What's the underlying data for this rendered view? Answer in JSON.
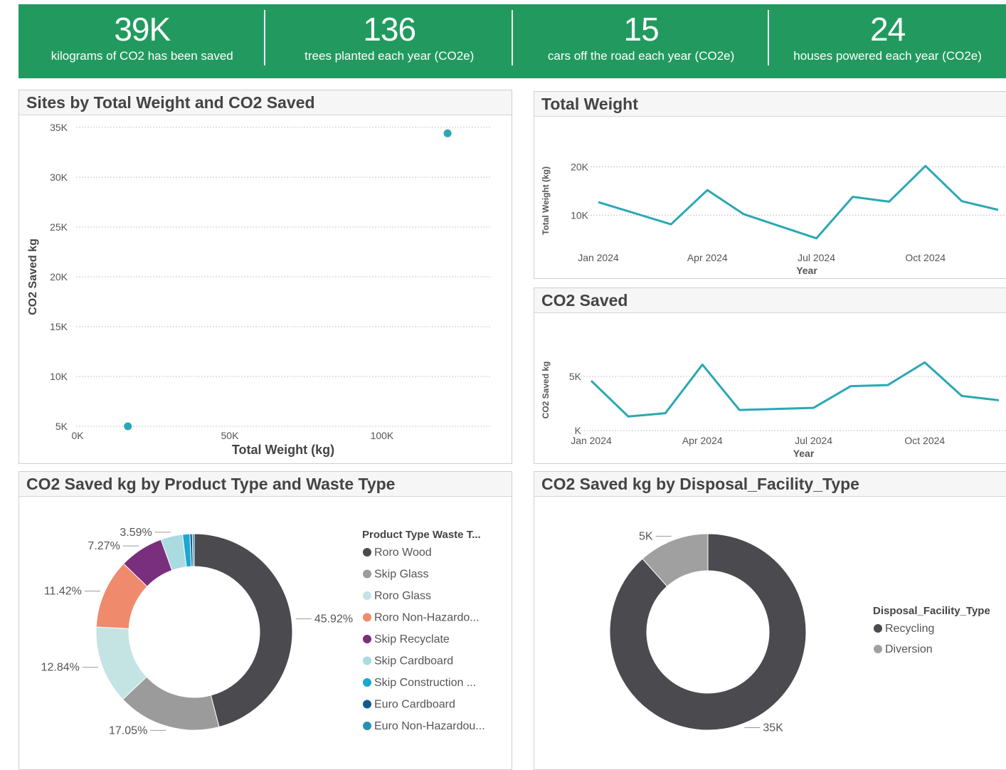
{
  "kpis": [
    {
      "value": "39K",
      "label": "kilograms of CO2 has been saved"
    },
    {
      "value": "136",
      "label": "trees planted each year (CO2e)"
    },
    {
      "value": "15",
      "label": "cars off the road each year (CO2e)"
    },
    {
      "value": "24",
      "label": "houses powered each year (CO2e)"
    }
  ],
  "panels": {
    "scatter_title": "Sites by Total Weight and CO2 Saved",
    "weight_title": "Total Weight",
    "co2_title": "CO2 Saved",
    "product_title": "CO2 Saved kg by Product Type and Waste Type",
    "facility_title": "CO2 Saved kg by Disposal_Facility_Type"
  },
  "colors": {
    "kpi_bg": "#229a5f",
    "line": "#2aa8b4",
    "dot": "#2aa8b4"
  },
  "chart_data": [
    {
      "id": "scatter",
      "type": "scatter",
      "title": "Sites by Total Weight and CO2 Saved",
      "xlabel": "Total Weight (kg)",
      "ylabel": "CO2 Saved kg",
      "xlim": [
        0,
        136000
      ],
      "ylim": [
        5000,
        35000
      ],
      "x_ticks": [
        "0K",
        "50K",
        "100K"
      ],
      "x_tick_values": [
        0,
        50000,
        100000
      ],
      "y_ticks": [
        "5K",
        "10K",
        "15K",
        "20K",
        "25K",
        "30K",
        "35K"
      ],
      "y_tick_values": [
        5000,
        10000,
        15000,
        20000,
        25000,
        30000,
        35000
      ],
      "points": [
        {
          "x": 17000,
          "y": 5000
        },
        {
          "x": 122000,
          "y": 34400
        }
      ],
      "grid": true
    },
    {
      "id": "weight",
      "type": "line",
      "title": "Total Weight",
      "xlabel": "Year",
      "ylabel": "Total Weight (kg)",
      "x": [
        "2024-01",
        "2024-02",
        "2024-03",
        "2024-04",
        "2024-05",
        "2024-06",
        "2024-07",
        "2024-08",
        "2024-09",
        "2024-10",
        "2024-11",
        "2024-12"
      ],
      "x_ticks": [
        "Jan 2024",
        "Apr 2024",
        "Jul 2024",
        "Oct 2024"
      ],
      "x_tick_index": [
        0,
        3,
        6,
        9
      ],
      "values": [
        12700,
        10400,
        8100,
        15200,
        10200,
        7700,
        5200,
        13800,
        12800,
        20200,
        12900,
        11100
      ],
      "ylim": [
        4000,
        22000
      ],
      "y_ticks": [
        "10K",
        "20K"
      ],
      "y_tick_values": [
        10000,
        20000
      ],
      "grid": true
    },
    {
      "id": "co2",
      "type": "line",
      "title": "CO2 Saved",
      "xlabel": "Year",
      "ylabel": "CO2 Saved kg",
      "x": [
        "2024-01",
        "2024-02",
        "2024-03",
        "2024-04",
        "2024-05",
        "2024-06",
        "2024-07",
        "2024-08",
        "2024-09",
        "2024-10",
        "2024-11",
        "2024-12"
      ],
      "x_ticks": [
        "Jan 2024",
        "Apr 2024",
        "Jul 2024",
        "Oct 2024"
      ],
      "x_tick_index": [
        0,
        3,
        6,
        9
      ],
      "values": [
        4600,
        1300,
        1600,
        6100,
        1900,
        2000,
        2100,
        4100,
        4200,
        6300,
        3200,
        2800
      ],
      "ylim": [
        0,
        7500
      ],
      "y_ticks": [
        "K",
        "5K"
      ],
      "y_tick_values": [
        0,
        5000
      ],
      "grid": true
    },
    {
      "id": "product",
      "type": "pie",
      "donut": true,
      "title": "CO2 Saved kg by Product Type and Waste Type",
      "legend_title": "Product Type Waste T...",
      "legend_position": "right",
      "slices": [
        {
          "label": "Roro Wood",
          "value": 45.92,
          "color": "#4a4a4f",
          "display": "45.92%"
        },
        {
          "label": "Skip Glass",
          "value": 17.05,
          "color": "#9b9b9b",
          "display": "17.05%"
        },
        {
          "label": "Roro Glass",
          "value": 12.84,
          "color": "#c4e3e3",
          "display": "12.84%"
        },
        {
          "label": "Roro Non-Hazardo...",
          "value": 11.42,
          "color": "#ef8a6c",
          "display": "11.42%"
        },
        {
          "label": "Skip Recyclate",
          "value": 7.27,
          "color": "#7a2e7e",
          "display": "7.27%"
        },
        {
          "label": "Skip Cardboard",
          "value": 3.59,
          "color": "#a9dbe0",
          "display": "3.59%"
        },
        {
          "label": "Skip Construction ...",
          "value": 1.2,
          "color": "#1ca7d0",
          "display": ""
        },
        {
          "label": "Euro Cardboard",
          "value": 0.4,
          "color": "#125a8c",
          "display": ""
        },
        {
          "label": "Euro Non-Hazardou...",
          "value": 0.31,
          "color": "#2a8fb0",
          "display": ""
        }
      ]
    },
    {
      "id": "facility",
      "type": "pie",
      "donut": true,
      "title": "CO2 Saved kg by Disposal_Facility_Type",
      "legend_title": "Disposal_Facility_Type",
      "legend_position": "right",
      "slices": [
        {
          "label": "Recycling",
          "value": 35000,
          "color": "#4a4a4f",
          "display": "35K"
        },
        {
          "label": "Diversion",
          "value": 4600,
          "color": "#a0a0a0",
          "display": "5K"
        }
      ]
    }
  ]
}
